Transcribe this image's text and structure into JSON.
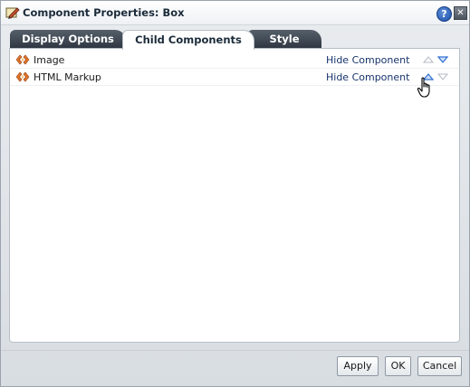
{
  "window": {
    "title": "Component Properties: Box",
    "help_label": "?",
    "close_label": "✕"
  },
  "tabs": [
    {
      "label": "Display Options",
      "active": false
    },
    {
      "label": "Child Components",
      "active": true
    },
    {
      "label": "Style",
      "active": false
    }
  ],
  "components": [
    {
      "name": "Image",
      "action": "Hide Component",
      "icon": "component-icon"
    },
    {
      "name": "HTML Markup",
      "action": "Hide Component",
      "icon": "component-icon"
    }
  ],
  "buttons": {
    "apply": "Apply",
    "ok": "OK",
    "cancel": "Cancel"
  },
  "colors": {
    "tab_dark": "#3a434d",
    "link": "#16336b",
    "icon_orange": "#e0742a",
    "arrow_blue": "#2f6fd0",
    "arrow_gray": "#b5bbc2"
  }
}
